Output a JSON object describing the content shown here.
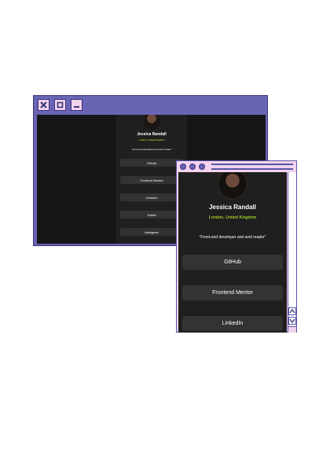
{
  "back_window": {
    "controls": [
      "close-icon",
      "maximize-icon",
      "minimize-icon"
    ],
    "profile": {
      "name": "Jessica Randall",
      "location": "London, United Kingdom",
      "bio": "\"Front-end developer and avid reader\""
    },
    "links": [
      "GitHub",
      "Frontend Mentor",
      "LinkedIn",
      "Twitter",
      "Instagram"
    ]
  },
  "front_window": {
    "title_dots": 3,
    "profile": {
      "name": "Jessica Randall",
      "location": "London, United Kingdom",
      "bio": "\"Front-end developer and avid reader\""
    },
    "links": [
      "GitHub",
      "Frontend Mentor",
      "LinkedIn"
    ],
    "scroll": {
      "up_icon": "chevron-up-icon",
      "down_icon": "chevron-down-icon"
    }
  },
  "colors": {
    "window_frame": "#6a64b4",
    "window_titlebar_light": "#f3d3ee",
    "screen_bg": "#161616",
    "card_bg": "#1f1f1f",
    "button_bg": "#333333",
    "accent_green": "#c4f82a",
    "text": "#ffffff"
  }
}
